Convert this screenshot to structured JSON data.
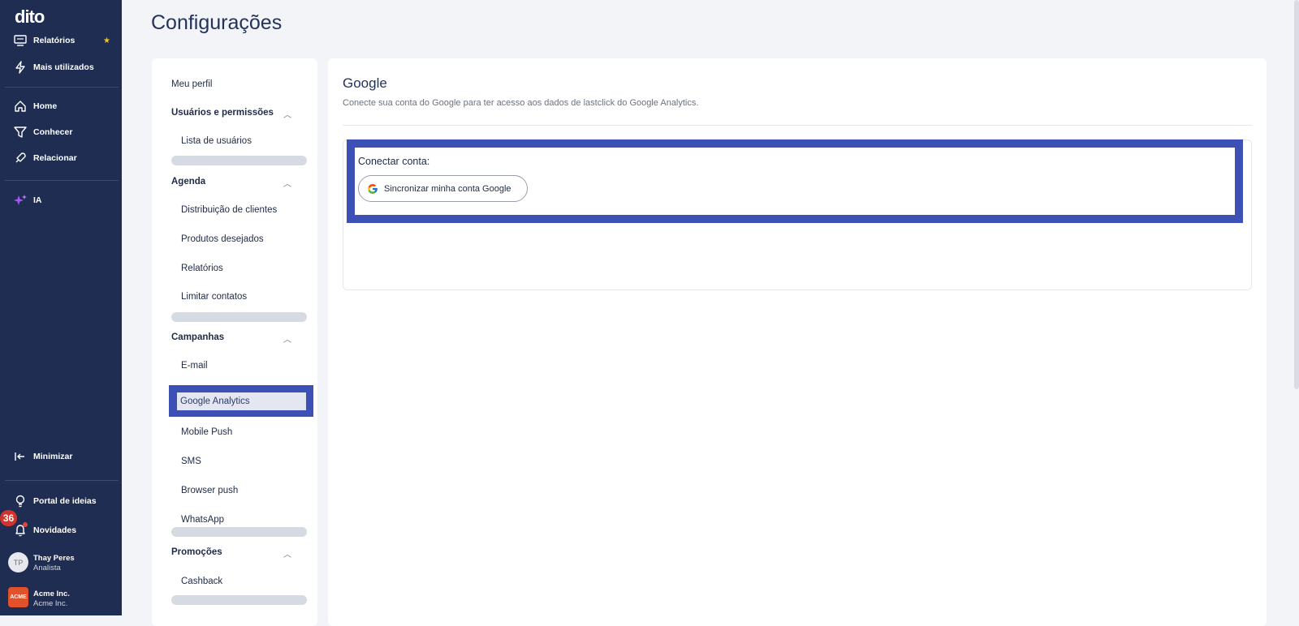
{
  "sidebar": {
    "logo": "dito",
    "items": [
      {
        "label": "Relatórios",
        "icon": "report-icon"
      },
      {
        "label": "Mais utilizados",
        "icon": "lightning-icon"
      },
      {
        "label": "Home",
        "icon": "home-icon"
      },
      {
        "label": "Conhecer",
        "icon": "filter-icon"
      },
      {
        "label": "Relacionar",
        "icon": "rocket-icon"
      },
      {
        "label": "IA",
        "icon": "sparkles-icon"
      }
    ],
    "minimize": "Minimizar",
    "ideas_portal": "Portal de ideias",
    "news": "Novidades",
    "news_badge": "36",
    "user": {
      "initials": "TP",
      "name": "Thay Peres",
      "role": "Analista"
    },
    "company": {
      "logo_text": "ACME",
      "name": "Acme Inc.",
      "sub": "Acme Inc."
    },
    "favorite_color": "#f5c518"
  },
  "page": {
    "title": "Configurações"
  },
  "settings_nav": {
    "profile": "Meu perfil",
    "sections": [
      {
        "title": "Usuários e permissões",
        "items": [
          "Lista de usuários"
        ]
      },
      {
        "title": "Agenda",
        "items": [
          "Distribuição de clientes",
          "Produtos desejados",
          "Relatórios",
          "Limitar contatos"
        ]
      },
      {
        "title": "Campanhas",
        "items": [
          "E-mail",
          "Google Analytics",
          "Mobile Push",
          "SMS",
          "Browser push",
          "WhatsApp"
        ]
      },
      {
        "title": "Promoções",
        "items": [
          "Cashback"
        ]
      }
    ],
    "selected": "Google Analytics"
  },
  "main": {
    "title": "Google",
    "description": "Conecte sua conta do Google para ter acesso aos dados de lastclick do Google Analytics.",
    "connect_label": "Conectar conta:",
    "google_button": "Sincronizar minha conta Google"
  },
  "colors": {
    "sidebar_bg": "#1f2d52",
    "highlight": "#3d50b5",
    "page_bg": "#f2f4f8"
  }
}
